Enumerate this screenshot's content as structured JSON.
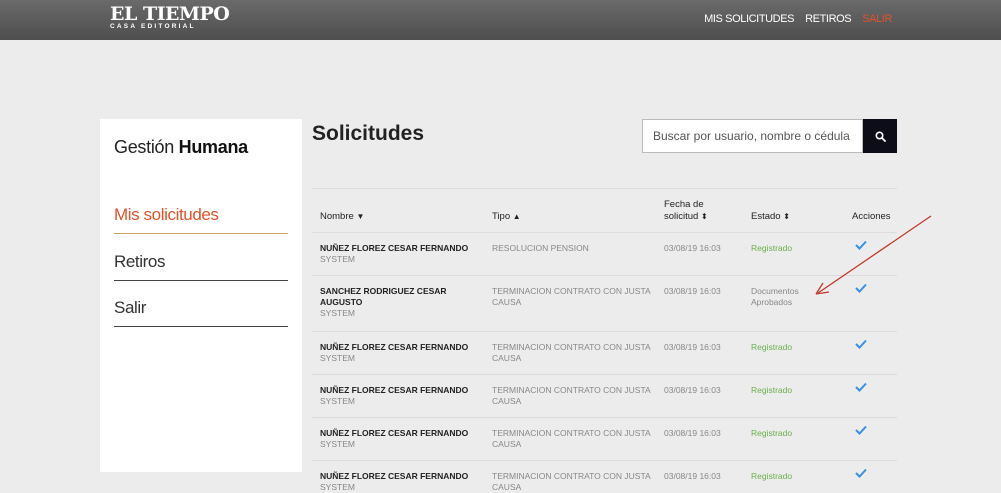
{
  "brand": {
    "name": "EL TIEMPO",
    "subtitle": "CASA EDITORIAL"
  },
  "topnav": [
    {
      "label": "MIS SOLICITUDES"
    },
    {
      "label": "RETIROS"
    },
    {
      "label": "SALIR"
    }
  ],
  "sidebar": {
    "title_light": "Gestión",
    "title_bold": "Humana",
    "items": [
      {
        "label": "Mis solicitudes",
        "active": true
      },
      {
        "label": "Retiros"
      },
      {
        "label": "Salir"
      }
    ]
  },
  "main": {
    "title": "Solicitudes",
    "search": {
      "placeholder": "Buscar por usuario, nombre o cédula",
      "button_icon": "search-icon"
    },
    "columns": {
      "nombre": "Nombre",
      "tipo": "Tipo",
      "fecha_line1": "Fecha de",
      "fecha_line2": "solicitud",
      "estado": "Estado",
      "acciones": "Acciones"
    },
    "rows": [
      {
        "name": "NUÑEZ FLOREZ CESAR FERNANDO",
        "by": "SYSTEM",
        "tipo": "RESOLUCION PENSION",
        "fecha": "03/08/19 16:03",
        "estado": "Registrado",
        "status": "registered"
      },
      {
        "name": "SANCHEZ RODRIGUEZ CESAR AUGUSTO",
        "by": "SYSTEM",
        "tipo": "TERMINACION CONTRATO CON JUSTA CAUSA",
        "fecha": "03/08/19 16:03",
        "estado": "Documentos Aprobados",
        "status": "approved"
      },
      {
        "name": "NUÑEZ FLOREZ CESAR FERNANDO",
        "by": "SYSTEM",
        "tipo": "TERMINACION CONTRATO CON JUSTA CAUSA",
        "fecha": "03/08/19 16:03",
        "estado": "Registrado",
        "status": "registered"
      },
      {
        "name": "NUÑEZ FLOREZ CESAR FERNANDO",
        "by": "SYSTEM",
        "tipo": "TERMINACION CONTRATO CON JUSTA CAUSA",
        "fecha": "03/08/19 16:03",
        "estado": "Registrado",
        "status": "registered"
      },
      {
        "name": "NUÑEZ FLOREZ CESAR FERNANDO",
        "by": "SYSTEM",
        "tipo": "TERMINACION CONTRATO CON JUSTA CAUSA",
        "fecha": "03/08/19 16:03",
        "estado": "Registrado",
        "status": "registered"
      },
      {
        "name": "NUÑEZ FLOREZ CESAR FERNANDO",
        "by": "SYSTEM",
        "tipo": "TERMINACION CONTRATO CON JUSTA CAUSA",
        "fecha": "03/08/19 16:03",
        "estado": "Registrado",
        "status": "registered"
      }
    ]
  },
  "colors": {
    "topbar": "#555555",
    "accent_orange": "#e0532a",
    "status_green": "#6ab04c",
    "check_blue": "#3a8ee6",
    "annotation_red": "#c0392b",
    "search_button": "#0d0d1a"
  }
}
